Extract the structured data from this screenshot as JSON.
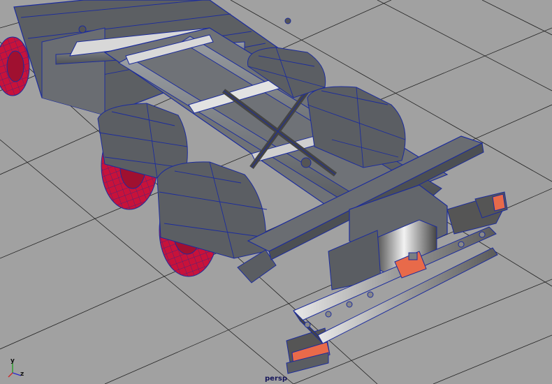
{
  "viewport": {
    "camera_name": "persp",
    "axis_labels": {
      "y": "y",
      "z": "z"
    },
    "colors": {
      "background": "#a1a1a1",
      "grid": "#202020",
      "mesh_fill": "#55585c",
      "mesh_fill_light": "#7a7e83",
      "wireframe": "#1c2c9c",
      "wheel_red": "#c8123a",
      "light_lens": "#e86a4a"
    }
  }
}
